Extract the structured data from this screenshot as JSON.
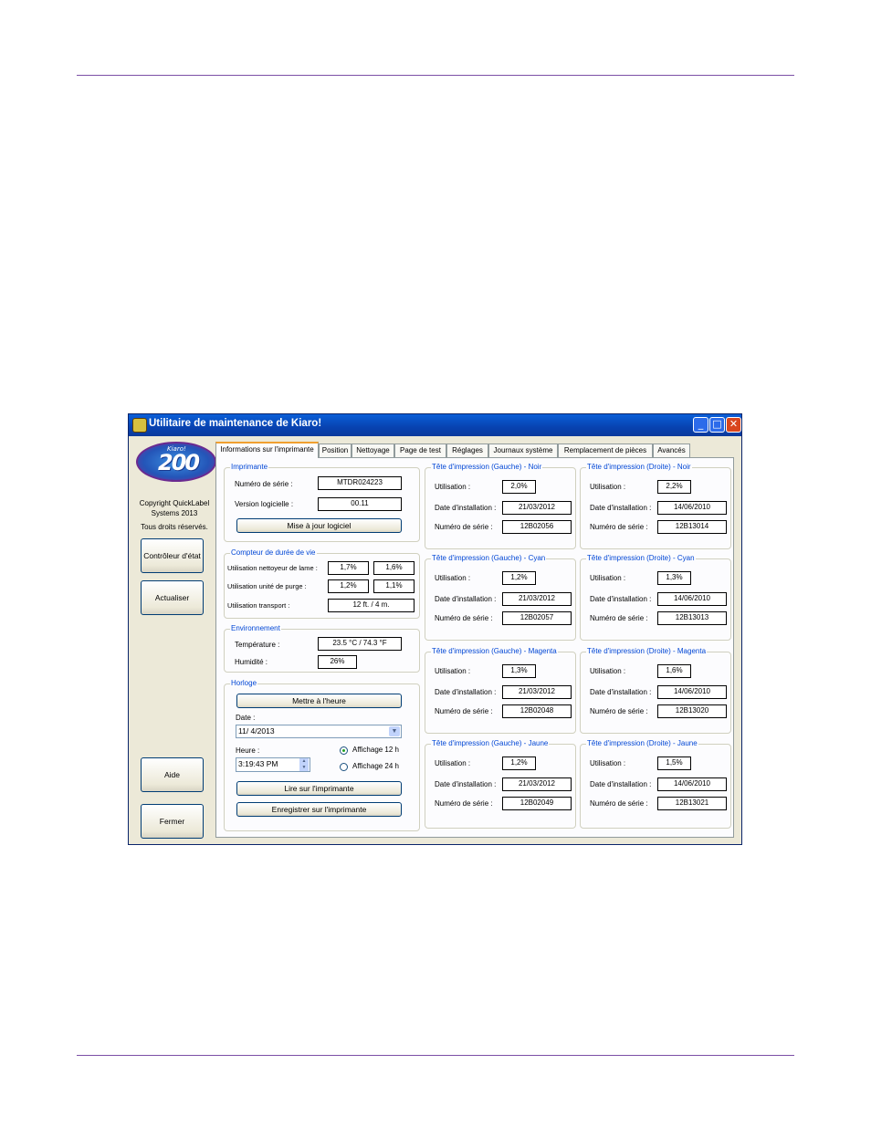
{
  "window": {
    "title": "Utilitaire de maintenance de Kiaro!",
    "icon": "app-icon",
    "controls": {
      "minimize": "_",
      "maximize": "□",
      "close": "✕"
    }
  },
  "sidebar": {
    "logo_small": "Kiaro!",
    "logo_big": "200",
    "copyright": "Copyright QuickLabel Systems 2013",
    "rights": "Tous droits réservés.",
    "status_button": "Contrôleur d'état",
    "refresh_button": "Actualiser",
    "help_button": "Aide",
    "close_button": "Fermer"
  },
  "tabs": [
    {
      "label": "Informations sur l'imprimante"
    },
    {
      "label": "Position"
    },
    {
      "label": "Nettoyage"
    },
    {
      "label": "Page de test"
    },
    {
      "label": "Réglages"
    },
    {
      "label": "Journaux système"
    },
    {
      "label": "Remplacement de pièces"
    },
    {
      "label": "Avancés"
    }
  ],
  "printer": {
    "title": "Imprimante",
    "serial_label": "Numéro de série :",
    "serial_value": "MTDR024223",
    "version_label": "Version logicielle :",
    "version_value": "00.11",
    "update_button": "Mise à jour logiciel"
  },
  "counters": {
    "title": "Compteur de durée de vie",
    "blade_label": "Utilisation nettoyeur de lame :",
    "blade_v1": "1,7%",
    "blade_v2": "1,6%",
    "purge_label": "Utilisation unité de purge :",
    "purge_v1": "1,2%",
    "purge_v2": "1,1%",
    "transport_label": "Utilisation transport :",
    "transport_value": "12 ft. / 4 m."
  },
  "environment": {
    "title": "Environnement",
    "temp_label": "Température :",
    "temp_value": "23.5 °C / 74.3 °F",
    "humidity_label": "Humidité :",
    "humidity_value": "26%"
  },
  "clock": {
    "title": "Horloge",
    "set_time_button": "Mettre à l'heure",
    "date_label": "Date :",
    "date_value": "11/  4/2013",
    "time_label": "Heure :",
    "time_value": "3:19:43 PM",
    "radio_12h": "Affichage 12 h",
    "radio_24h": "Affichage 24 h",
    "read_button": "Lire sur l'imprimante",
    "save_button": "Enregistrer sur l'imprimante"
  },
  "heads": {
    "util_label": "Utilisation :",
    "date_label": "Date d'installation :",
    "serial_label": "Numéro de série :",
    "left": [
      {
        "title": "Tête d'impression (Gauche) - Noir",
        "util": "2,0%",
        "date": "21/03/2012",
        "serial": "12B02056"
      },
      {
        "title": "Tête d'impression (Gauche) - Cyan",
        "util": "1,2%",
        "date": "21/03/2012",
        "serial": "12B02057"
      },
      {
        "title": "Tête d'impression (Gauche) - Magenta",
        "util": "1,3%",
        "date": "21/03/2012",
        "serial": "12B02048"
      },
      {
        "title": "Tête d'impression (Gauche) - Jaune",
        "util": "1,2%",
        "date": "21/03/2012",
        "serial": "12B02049"
      }
    ],
    "right": [
      {
        "title": "Tête d'impression (Droite) - Noir",
        "util": "2,2%",
        "date": "14/06/2010",
        "serial": "12B13014"
      },
      {
        "title": "Tête d'impression (Droite) - Cyan",
        "util": "1,3%",
        "date": "14/06/2010",
        "serial": "12B13013"
      },
      {
        "title": "Tête d'impression (Droite) - Magenta",
        "util": "1,6%",
        "date": "14/06/2010",
        "serial": "12B13020"
      },
      {
        "title": "Tête d'impression (Droite) - Jaune",
        "util": "1,5%",
        "date": "14/06/2010",
        "serial": "12B13021"
      }
    ]
  }
}
